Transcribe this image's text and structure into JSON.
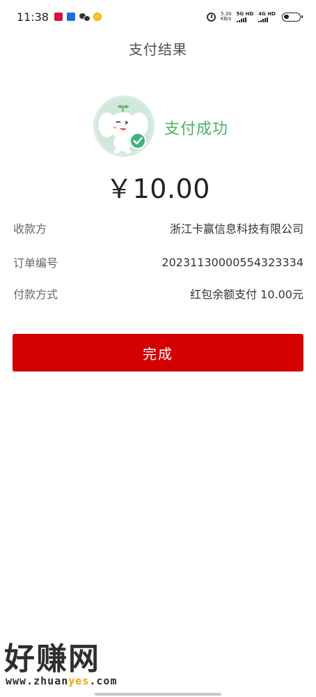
{
  "status_bar": {
    "time": "11:38",
    "net_speed_value": "5.30",
    "net_speed_unit": "KB/s",
    "sim1_label": "5G HD",
    "sim2_label": "4G HD"
  },
  "header": {
    "title": "支付结果"
  },
  "result": {
    "status_text": "支付成功",
    "amount": "￥10.00",
    "status_color": "#4caf66"
  },
  "details": [
    {
      "label": "收款方",
      "value": "浙江卡赢信息科技有限公司"
    },
    {
      "label": "订单编号",
      "value": "20231130000554323334"
    },
    {
      "label": "付款方式",
      "value": "红包余额支付 10.00元"
    }
  ],
  "actions": {
    "done_label": "完成",
    "button_color": "#d20000"
  },
  "watermark": {
    "text": "好赚网",
    "url_prefix": "www.zhuan",
    "url_highlight": "yes",
    "url_suffix": ".com"
  },
  "icons": [
    "alarm-icon",
    "battery-icon",
    "signal-icon",
    "success-check-icon",
    "elephant-mascot"
  ]
}
